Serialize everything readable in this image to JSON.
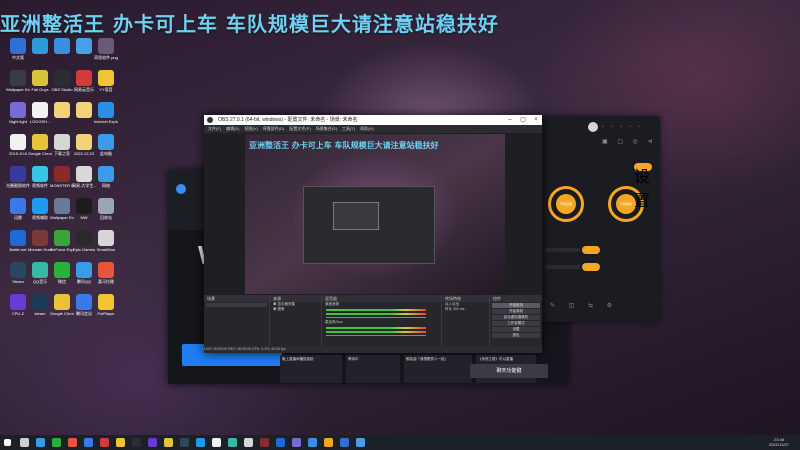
{
  "headline": "亚洲整活王 办卡可上车 车队规模巨大请注意站稳扶好",
  "desktop_icons": [
    {
      "label": "中文版",
      "color": "#2f6fd6"
    },
    {
      "label": "",
      "color": "#2e9bd8"
    },
    {
      "label": "",
      "color": "#3c8fe0"
    },
    {
      "label": "",
      "color": "#4aa0e8"
    },
    {
      "label": "奇怪软件.png",
      "color": "#6a5a7a"
    },
    {
      "label": "Wallpaper Engine",
      "color": "#3b3b46"
    },
    {
      "label": "Fall Guys",
      "color": "#d8c23a"
    },
    {
      "label": "OBS Studio",
      "color": "#2c2c33"
    },
    {
      "label": "网易云音乐",
      "color": "#d33a3a"
    },
    {
      "label": "YY语音",
      "color": "#f2c431"
    },
    {
      "label": "Night light",
      "color": "#7a6ad8"
    },
    {
      "label": "LOGOSH...",
      "color": "#f2f2f2"
    },
    {
      "label": "",
      "color": "#f2d27a"
    },
    {
      "label": "",
      "color": "#f2d27a"
    },
    {
      "label": "Internet Explorer",
      "color": "#2a8fe8"
    },
    {
      "label": "2019.10.6",
      "color": "#f2f2f2"
    },
    {
      "label": "Google Chrome",
      "color": "#e8c23a"
    },
    {
      "label": "下载之家",
      "color": "#d6d6d6"
    },
    {
      "label": "2022.12.23",
      "color": "#f2d27a"
    },
    {
      "label": "此电脑",
      "color": "#3a9be8"
    },
    {
      "label": "光圈截图软件",
      "color": "#3a3a9e"
    },
    {
      "label": "视频软件",
      "color": "#3ac4e8"
    },
    {
      "label": "MONSTER HUNTER",
      "color": "#8a2a2a"
    },
    {
      "label": "网易-大学生...",
      "color": "#d8d8d8"
    },
    {
      "label": "网络",
      "color": "#3a9be8"
    },
    {
      "label": "迅雷",
      "color": "#3a7ae8"
    },
    {
      "label": "视频辅助",
      "color": "#1e9af0"
    },
    {
      "label": "Wallpaper Engine",
      "color": "#6a7a9a"
    },
    {
      "label": "MW",
      "color": "#1c1c1c"
    },
    {
      "label": "回收站",
      "color": "#9aa6b6"
    },
    {
      "label": "Battle.net",
      "color": "#1e6ad6"
    },
    {
      "label": "Monster Hunter",
      "color": "#7a3a3a"
    },
    {
      "label": "GeForce Experience",
      "color": "#3aa63a"
    },
    {
      "label": "Epic Games",
      "color": "#2a2a2a"
    },
    {
      "label": "SmartMon",
      "color": "#d6d6d6"
    },
    {
      "label": "Steam",
      "color": "#2a475e"
    },
    {
      "label": "QQ音乐",
      "color": "#3ab8a6"
    },
    {
      "label": "微信",
      "color": "#2ab13a"
    },
    {
      "label": "腾讯QQ",
      "color": "#3a9be8"
    },
    {
      "label": "喜马拉雅",
      "color": "#e8553a"
    },
    {
      "label": "CPU-Z",
      "color": "#6a3ad6"
    },
    {
      "label": "steam",
      "color": "#1e3a5a"
    },
    {
      "label": "Google Chrome",
      "color": "#e8c23a"
    },
    {
      "label": "腾讯会议",
      "color": "#3a7ae8"
    },
    {
      "label": "PotPlayer",
      "color": "#f2c431"
    }
  ],
  "obs": {
    "title": "OBS 27.0.1 (64-bit, windows) - 配置文件: 未命名 - 场景: 未命名",
    "menu": [
      "文件(F)",
      "编辑(E)",
      "视图(V)",
      "停靠部件(D)",
      "配置文件(P)",
      "场景集合(S)",
      "工具(T)",
      "帮助(H)"
    ],
    "preview_title": "亚洲整活王 办卡可上车 车队规模巨大请注意站稳扶好",
    "docks": {
      "scenes_header": "场景",
      "sources_header": "来源",
      "sources": [
        "显示器采集",
        "图像"
      ],
      "mixer_header": "混音器",
      "mixer_channels": [
        "桌面音频",
        "麦克风/Aux"
      ],
      "transitions_header": "转场特效",
      "transition_value": "淡入淡出",
      "duration_label": "时长",
      "duration_value": "300 ms",
      "controls_header": "控件",
      "controls": [
        "开始推流",
        "开始录制",
        "启动虚拟摄像机",
        "工作室模式",
        "设置",
        "退出"
      ]
    },
    "status": "LIVE: 00:00:00  REC: 00:00:00  CPU: 3.2%, 60.00 fps"
  },
  "stream_app": {
    "preview_letter": "W",
    "blue_button": "",
    "card_texts": [
      "晚上直播间播放激起",
      "等待中",
      "歌曲曲「我想跟別人一起」",
      "《永恒之塔》可以直播"
    ],
    "ready_button": "聊天功能键"
  },
  "right_panel": {
    "left_circle": "开始直播",
    "right_circle": "开始录制",
    "pill": "设置"
  },
  "taskbar": {
    "time": "23:48",
    "date": "2022/12/27"
  }
}
